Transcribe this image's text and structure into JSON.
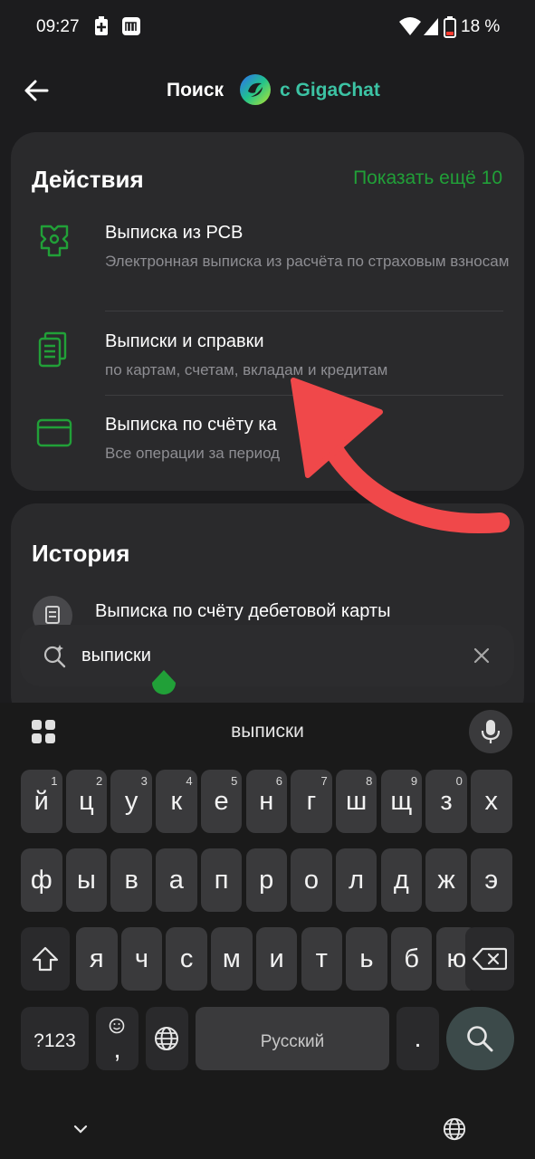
{
  "status_bar": {
    "time": "09:27",
    "battery": "18 %"
  },
  "header": {
    "title": "Поиск",
    "brand": "с GigaChat"
  },
  "actions": {
    "title": "Действия",
    "show_more": "Показать ещё 10",
    "items": [
      {
        "title": "Выписка из РСВ",
        "subtitle": "Электронная выписка из расчёта по страховым взносам",
        "icon": "rsv-document-icon"
      },
      {
        "title": "Выписки и справки",
        "subtitle": "по картам, счетам, вкладам и кредитам",
        "icon": "documents-stack-icon"
      },
      {
        "title": "Выписка по счёту ка",
        "subtitle": "Все операции за период",
        "icon": "card-icon"
      }
    ]
  },
  "history": {
    "title": "История",
    "items": [
      {
        "text": "Выписка по счёту дебетовой карты"
      }
    ]
  },
  "search": {
    "query": "выписки"
  },
  "keyboard": {
    "suggestion": "выписки",
    "row1": [
      {
        "k": "й",
        "h": "1"
      },
      {
        "k": "ц",
        "h": "2"
      },
      {
        "k": "у",
        "h": "3"
      },
      {
        "k": "к",
        "h": "4"
      },
      {
        "k": "е",
        "h": "5"
      },
      {
        "k": "н",
        "h": "6"
      },
      {
        "k": "г",
        "h": "7"
      },
      {
        "k": "ш",
        "h": "8"
      },
      {
        "k": "щ",
        "h": "9"
      },
      {
        "k": "з",
        "h": "0"
      },
      {
        "k": "х",
        "h": ""
      }
    ],
    "row2": [
      "ф",
      "ы",
      "в",
      "а",
      "п",
      "р",
      "о",
      "л",
      "д",
      "ж",
      "э"
    ],
    "row3": [
      "я",
      "ч",
      "с",
      "м",
      "и",
      "т",
      "ь",
      "б",
      "ю"
    ],
    "symbols_label": "?123",
    "comma": ",",
    "space_label": "Русский",
    "period": "."
  },
  "colors": {
    "accent_green": "#21a038",
    "annotation_arrow": "#f0484a",
    "giga_teal": "#3cc3a4"
  }
}
